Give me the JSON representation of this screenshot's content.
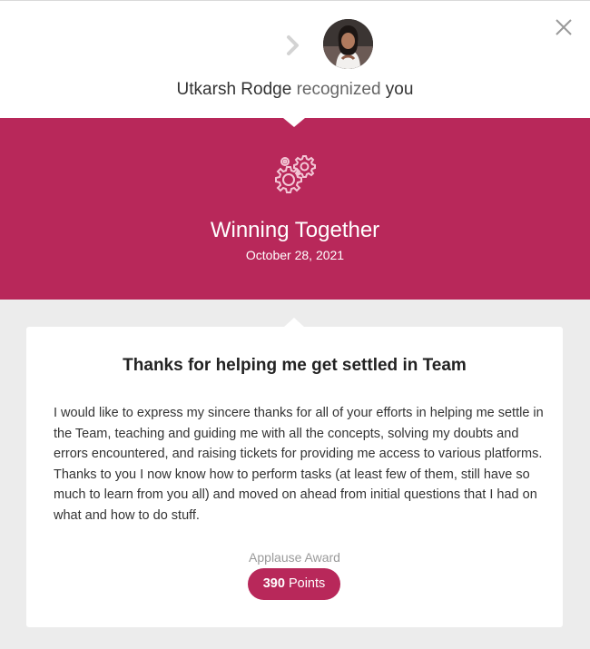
{
  "header": {
    "sender_name": "Utkarsh Rodge",
    "action_text": "recognized",
    "recipient": "you"
  },
  "award": {
    "title": "Winning Together",
    "date": "October 28, 2021"
  },
  "message": {
    "title": "Thanks for helping me get settled in Team",
    "body": "I would like to express my sincere thanks for all of your efforts in helping me settle in the Team, teaching and guiding me with all the concepts, solving my doubts and errors encountered, and raising tickets for providing me access to various platforms. Thanks to you I now know how to perform tasks (at least few of them, still have so much to learn from you all) and moved on ahead from initial questions that I had on what and how to do stuff."
  },
  "reward": {
    "type": "Applause Award",
    "points_value": "390",
    "points_label": "Points"
  },
  "icons": {
    "close": "close-icon",
    "chevron": "chevron-right-icon",
    "gears": "gears-icon",
    "avatar": "avatar"
  },
  "colors": {
    "brand": "#b8285a",
    "background": "#ececec",
    "card": "#ffffff"
  }
}
